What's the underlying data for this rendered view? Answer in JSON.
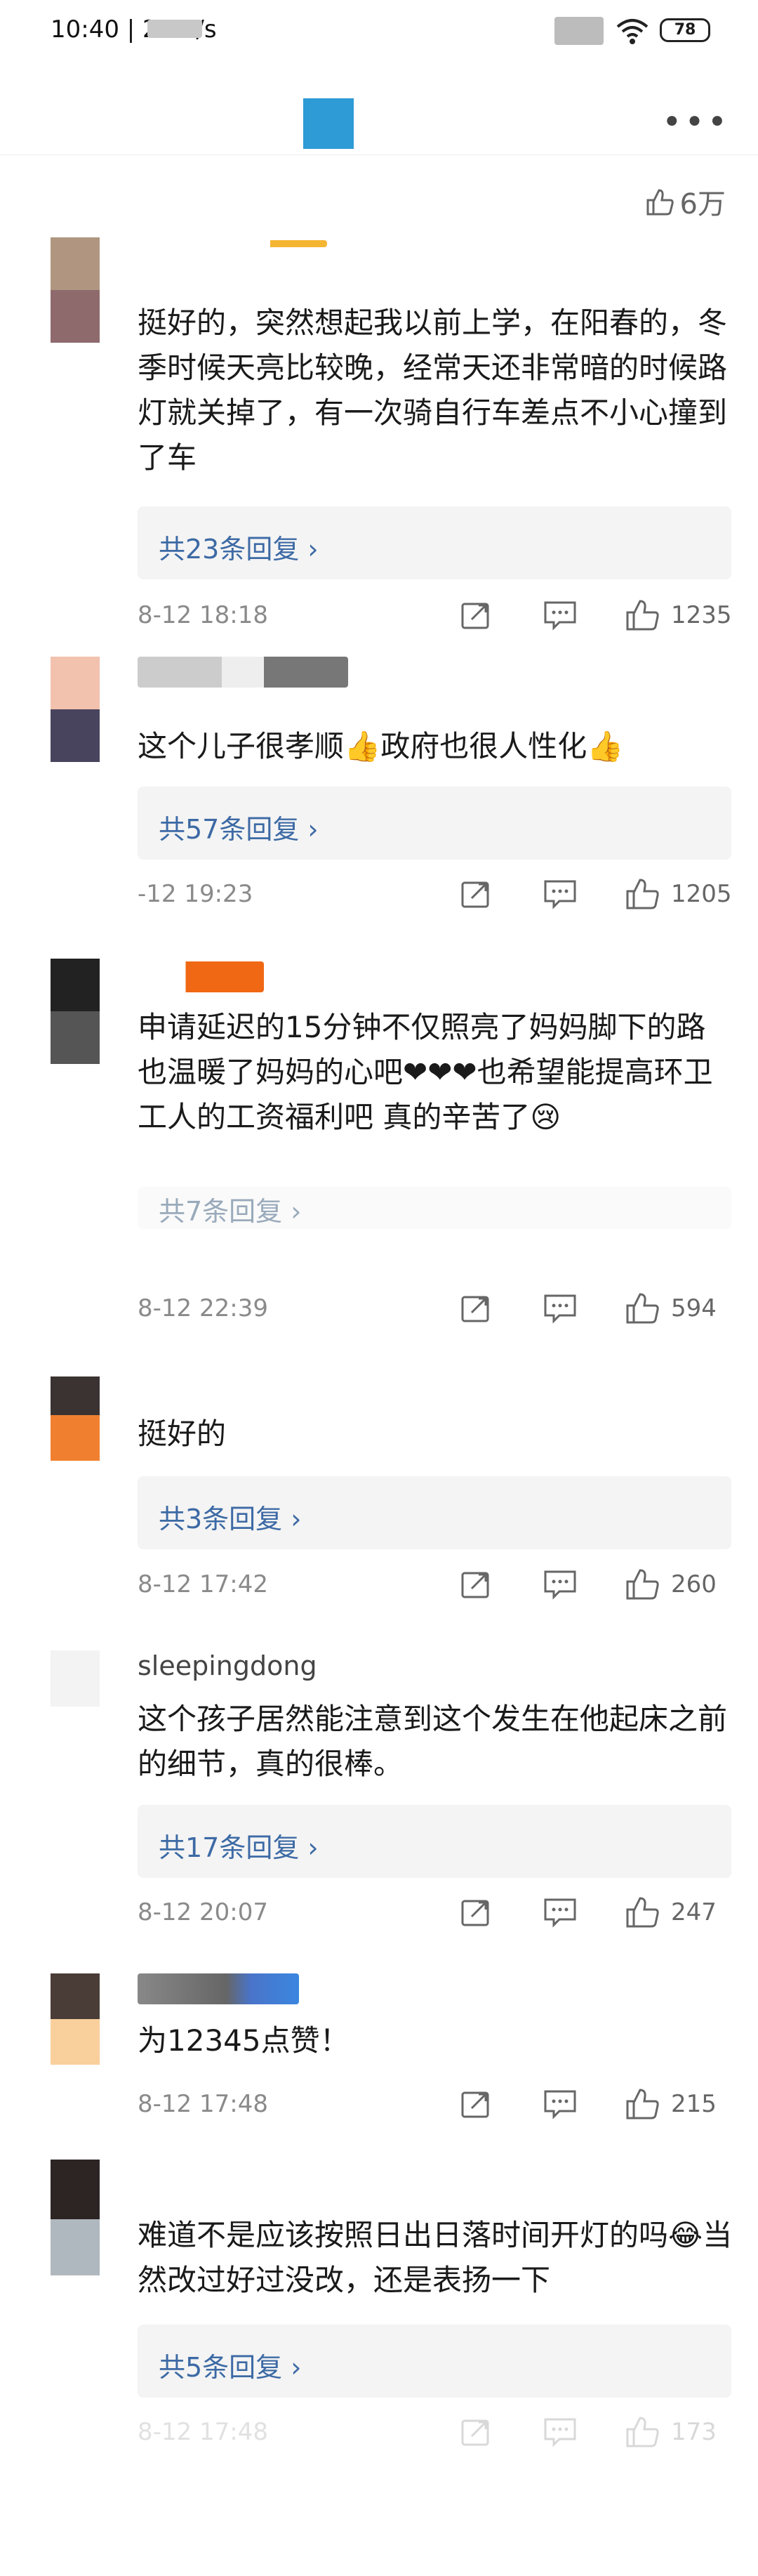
{
  "status": {
    "time": "10:40 | 2.7K/s",
    "battery": "78"
  },
  "header": {
    "like_total": "6万"
  },
  "colors": {
    "accent": "#2e9ad6",
    "link": "#3d6aa5",
    "meta": "#8a8a8a"
  },
  "icons": [
    "more-icon",
    "like-icon",
    "share-icon",
    "comment-icon"
  ],
  "comments": [
    {
      "username": "",
      "text": "挺好的，突然想起我以前上学，在阳春的，冬季时候天亮比较晚，经常天还非常暗的时候路灯就关掉了，有一次骑自行车差点不小心撞到了车",
      "replies": "共23条回复 ›",
      "date": "8-12 18:18",
      "likes": "1235"
    },
    {
      "username": "",
      "text": "这个儿子很孝顺👍政府也很人性化👍",
      "replies": "共57条回复 ›",
      "date": "-12 19:23",
      "likes": "1205"
    },
    {
      "username": "",
      "text": "申请延迟的15分钟不仅照亮了妈妈脚下的路 也温暖了妈妈的心吧❤❤❤也希望能提高环卫工人的工资福利吧 真的辛苦了😢",
      "replies": "共7条回复 ›",
      "date": "8-12 22:39",
      "likes": "594"
    },
    {
      "username": "",
      "text": "挺好的",
      "replies": "共3条回复 ›",
      "date": "8-12 17:42",
      "likes": "260"
    },
    {
      "username": "sleepingdong",
      "text": "这个孩子居然能注意到这个发生在他起床之前的细节，真的很棒。",
      "replies": "共17条回复 ›",
      "date": "8-12 20:07",
      "likes": "247"
    },
    {
      "username": "",
      "text": "为12345点赞！",
      "replies": "",
      "date": "8-12 17:48",
      "likes": "215"
    },
    {
      "username": "",
      "text": "难道不是应该按照日出日落时间开灯的吗😂当然改过好过没改，还是表扬一下",
      "replies": "共5条回复 ›",
      "date": "8-12 17:48",
      "likes": "173"
    }
  ]
}
